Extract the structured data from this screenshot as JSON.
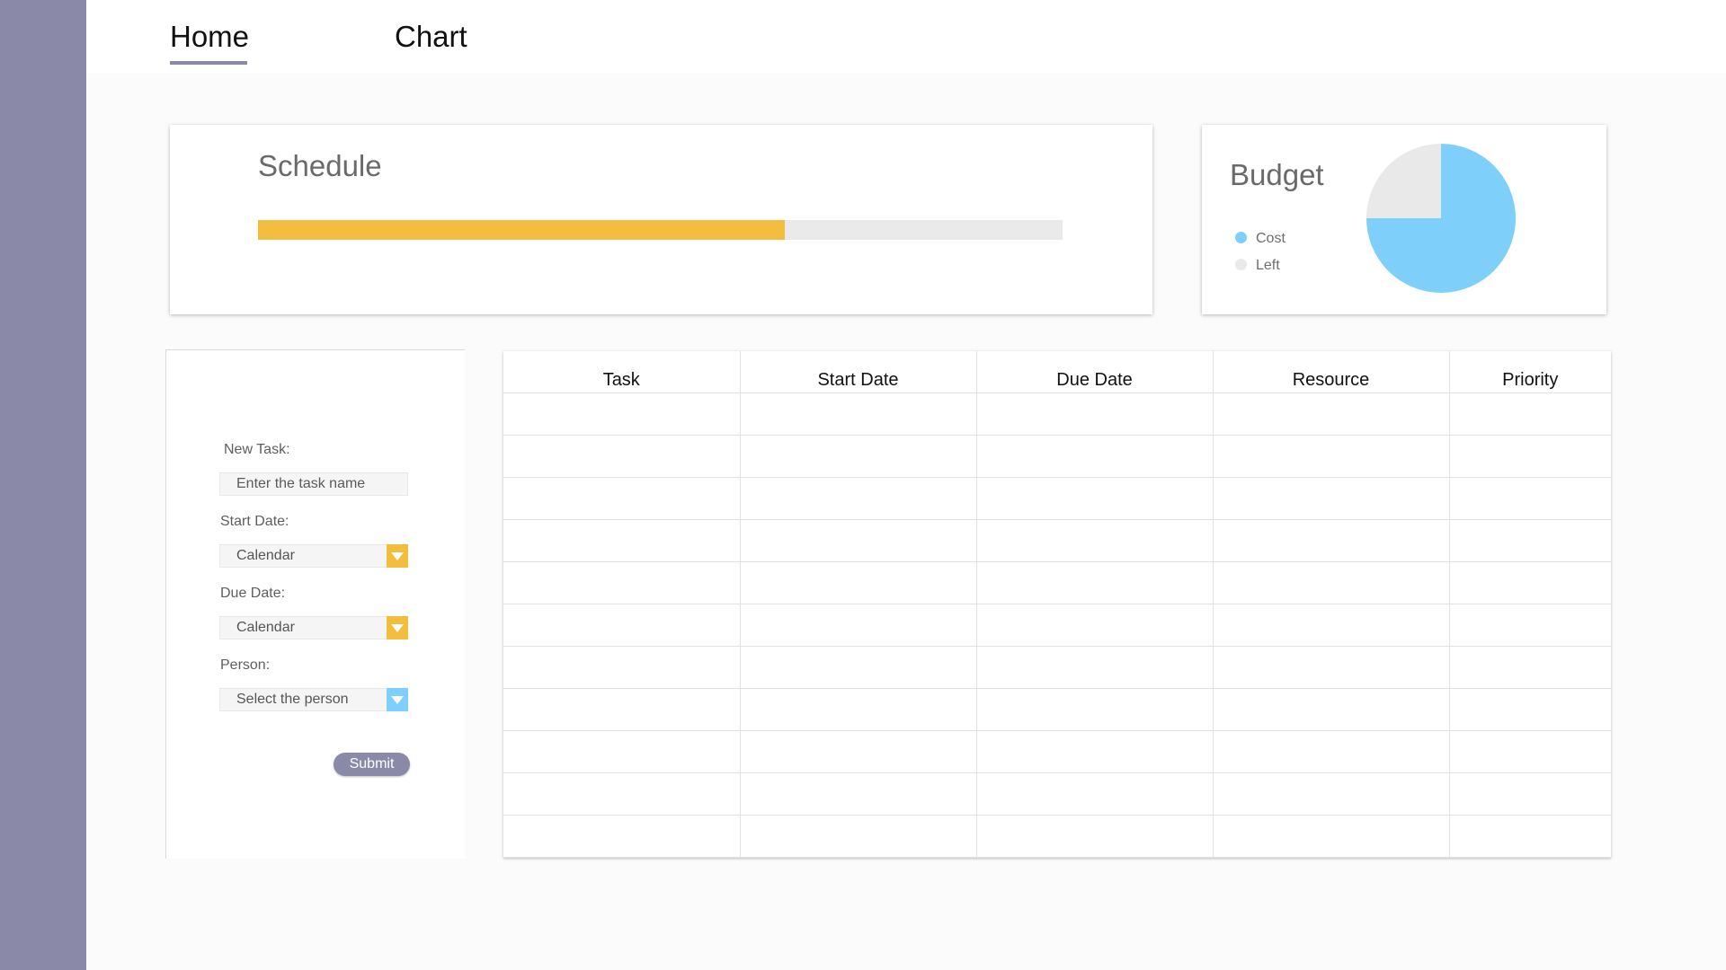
{
  "nav": {
    "tabs": [
      {
        "label": "Home",
        "active": true
      },
      {
        "label": "Chart",
        "active": false
      }
    ]
  },
  "colors": {
    "sidebar": "#8a89a8",
    "accent": "#8a89a8",
    "progress": "#f3bd3d",
    "track": "#eaeaea",
    "cost": "#7ed0fb",
    "left": "#e9e9e9",
    "dropdown_yellow": "#f3bd3d",
    "dropdown_blue": "#7ed0fb"
  },
  "schedule": {
    "title": "Schedule",
    "progress_fraction": 0.655
  },
  "budget": {
    "title": "Budget",
    "legend": [
      {
        "label": "Cost",
        "icon": "dot"
      },
      {
        "label": "Left",
        "icon": "dot"
      }
    ],
    "chart_data": {
      "type": "pie",
      "series": [
        {
          "name": "Cost",
          "value": 75
        },
        {
          "name": "Left",
          "value": 25
        }
      ]
    }
  },
  "form": {
    "new_task_label": "New Task:",
    "new_task_placeholder": "Enter the task name",
    "start_date_label": "Start Date:",
    "start_date_value": "Calendar",
    "due_date_label": "Due Date:",
    "due_date_value": "Calendar",
    "person_label": "Person:",
    "person_value": "Select the person",
    "submit_label": "Submit",
    "dropdown_icon": "triangle-down-icon"
  },
  "table": {
    "columns": [
      "Task",
      "Start Date",
      "Due Date",
      "Resource",
      "Priority"
    ],
    "row_count": 11
  }
}
